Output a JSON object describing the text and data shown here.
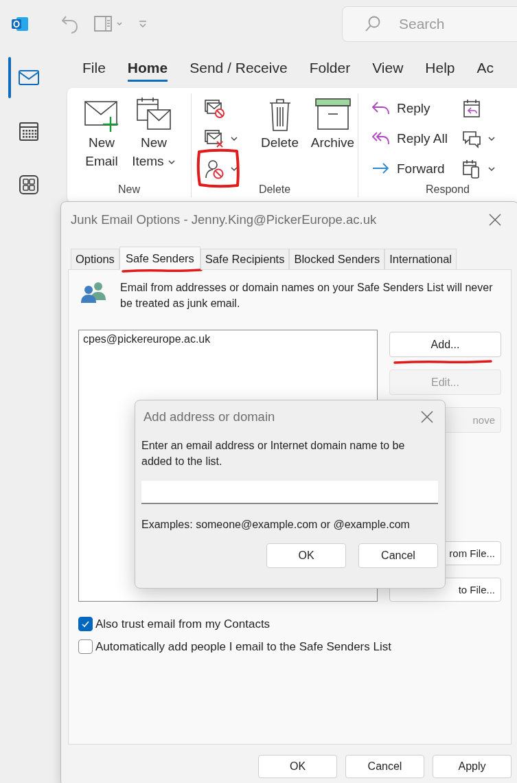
{
  "title_bar": {
    "search": {
      "placeholder": "Search"
    }
  },
  "nav_rail": [
    {
      "kind": "mail",
      "selected": true
    },
    {
      "kind": "calendar",
      "selected": false
    },
    {
      "kind": "apps",
      "selected": false
    }
  ],
  "ribbon_tabs": [
    {
      "label": "File",
      "selected": false
    },
    {
      "label": "Home",
      "selected": true
    },
    {
      "label": "Send / Receive",
      "selected": false
    },
    {
      "label": "Folder",
      "selected": false
    },
    {
      "label": "View",
      "selected": false
    },
    {
      "label": "Help",
      "selected": false
    },
    {
      "label": "Ac",
      "selected": false
    }
  ],
  "ribbon_groups": [
    {
      "label": "New",
      "items": [
        {
          "kind": "new-email",
          "label": "New Email"
        },
        {
          "kind": "new-items",
          "label": "New Items",
          "dropdown": true
        }
      ]
    },
    {
      "label": "Delete",
      "items": [
        {
          "kind": "stack",
          "buttons": [
            {
              "kind": "ignore"
            },
            {
              "kind": "cleanup",
              "dropdown": true
            },
            {
              "kind": "junk",
              "dropdown": true,
              "annotated": true
            }
          ]
        },
        {
          "kind": "delete",
          "label": "Delete"
        },
        {
          "kind": "archive",
          "label": "Archive"
        }
      ]
    },
    {
      "label": "Respond",
      "items": [
        {
          "kind": "stack",
          "buttons": [
            {
              "kind": "reply",
              "label": "Reply"
            },
            {
              "kind": "reply-all",
              "label": "Reply All"
            },
            {
              "kind": "forward",
              "label": "Forward"
            }
          ]
        },
        {
          "kind": "stack",
          "buttons": [
            {
              "kind": "meeting"
            },
            {
              "kind": "im",
              "dropdown": true
            },
            {
              "kind": "more",
              "dropdown": true
            }
          ]
        }
      ]
    }
  ],
  "junk_dialog": {
    "title": "Junk Email Options - Jenny.King@PickerEurope.ac.uk",
    "tabs": [
      {
        "label": "Options",
        "selected": false
      },
      {
        "label": "Safe Senders",
        "selected": true,
        "annotated": true
      },
      {
        "label": "Safe Recipients",
        "selected": false
      },
      {
        "label": "Blocked Senders",
        "selected": false
      },
      {
        "label": "International",
        "selected": false
      }
    ],
    "info": "Email from addresses or domain names on your Safe Senders List will never be treated as junk email.",
    "list": [
      "cpes@pickereurope.ac.uk"
    ],
    "buttons": [
      {
        "kind": "edit",
        "label": "Add...",
        "disabled": false,
        "annotated": true
      },
      {
        "kind": "edit",
        "label": "Edit...",
        "disabled": true
      },
      {
        "kind": "edit-cut",
        "label": "nove",
        "disabled": true
      },
      {
        "kind": "file-cut",
        "label": "rom File...",
        "disabled": false
      },
      {
        "kind": "file-cut",
        "label": "to File...",
        "disabled": false
      }
    ],
    "checkboxes": [
      {
        "label": "Also trust email from my Contacts",
        "checked": true
      },
      {
        "label": "Automatically add people I email to the Safe Senders List",
        "checked": false
      }
    ],
    "footer_buttons": [
      "OK",
      "Cancel",
      "Apply"
    ]
  },
  "add_dialog": {
    "title": "Add address or domain",
    "prompt": "Enter an email address or Internet domain name to be added to the list.",
    "examples": "Examples: someone@example.com or @example.com",
    "buttons": [
      "OK",
      "Cancel"
    ]
  }
}
